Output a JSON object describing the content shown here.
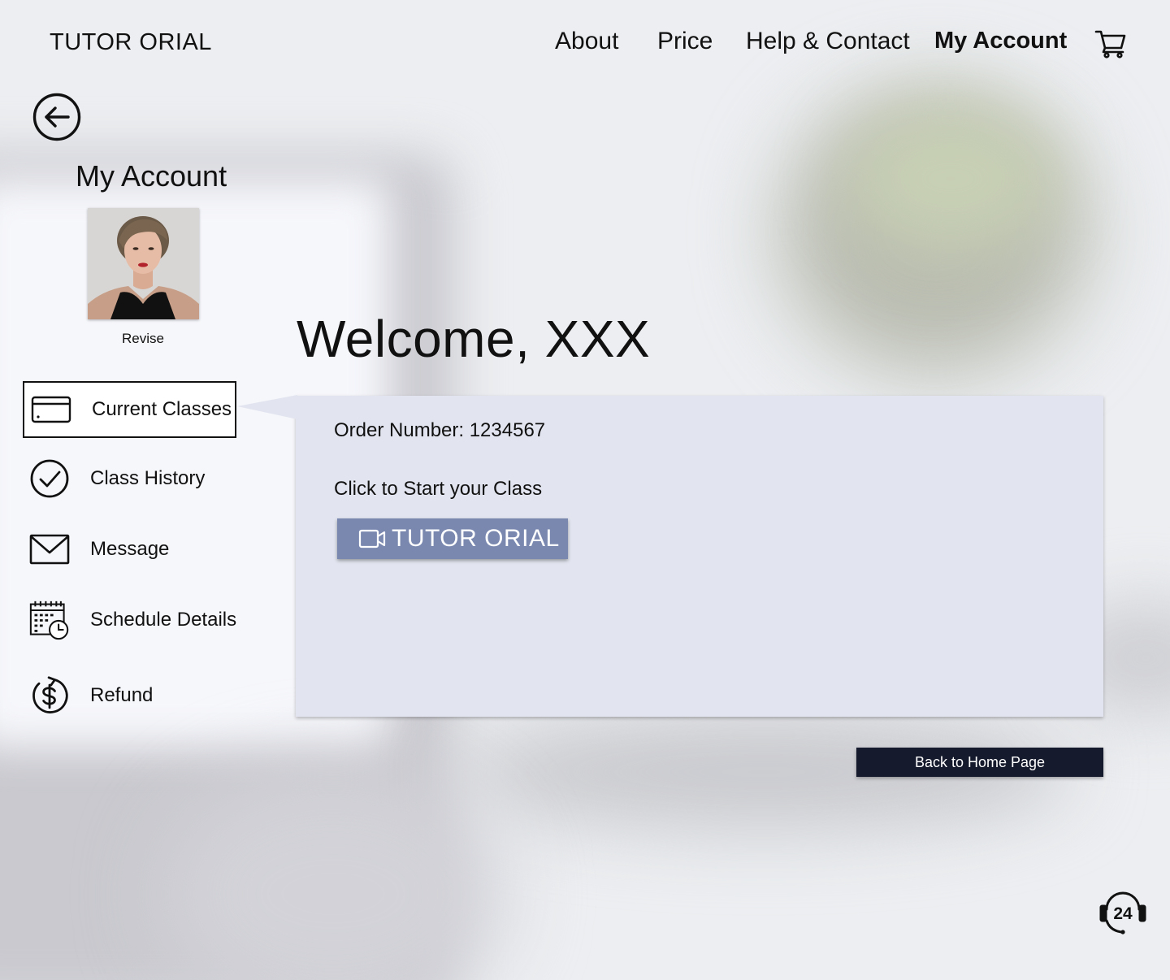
{
  "header": {
    "brand": "TUTOR ORIAL",
    "nav": {
      "about": "About",
      "price": "Price",
      "help": "Help & Contact",
      "account": "My Account"
    },
    "cart_icon": "shopping-cart-icon"
  },
  "sidebar": {
    "back_icon": "arrow-left-circle-icon",
    "title": "My Account",
    "avatar_alt": "profile photo",
    "revise_label": "Revise",
    "items": [
      {
        "label": "Current Classes",
        "icon": "credit-card-icon",
        "active": true
      },
      {
        "label": "Class History",
        "icon": "check-circle-icon",
        "active": false
      },
      {
        "label": "Message",
        "icon": "envelope-icon",
        "active": false
      },
      {
        "label": "Schedule Details",
        "icon": "calendar-clock-icon",
        "active": false
      },
      {
        "label": "Refund",
        "icon": "refund-dollar-icon",
        "active": false
      }
    ]
  },
  "main": {
    "welcome": "Welcome, XXX",
    "panel": {
      "order_number": "Order Number: 1234567",
      "start_prompt": "Click to Start your Class",
      "join_button_label": "TUTOR ORIAL",
      "join_button_icon": "video-camera-icon"
    },
    "back_home_label": "Back to Home Page"
  },
  "support_icon": "support-24-icon",
  "colors": {
    "panel_bg": "#e2e5ef",
    "join_button": "#7a88b0",
    "home_button": "#151a2c"
  }
}
